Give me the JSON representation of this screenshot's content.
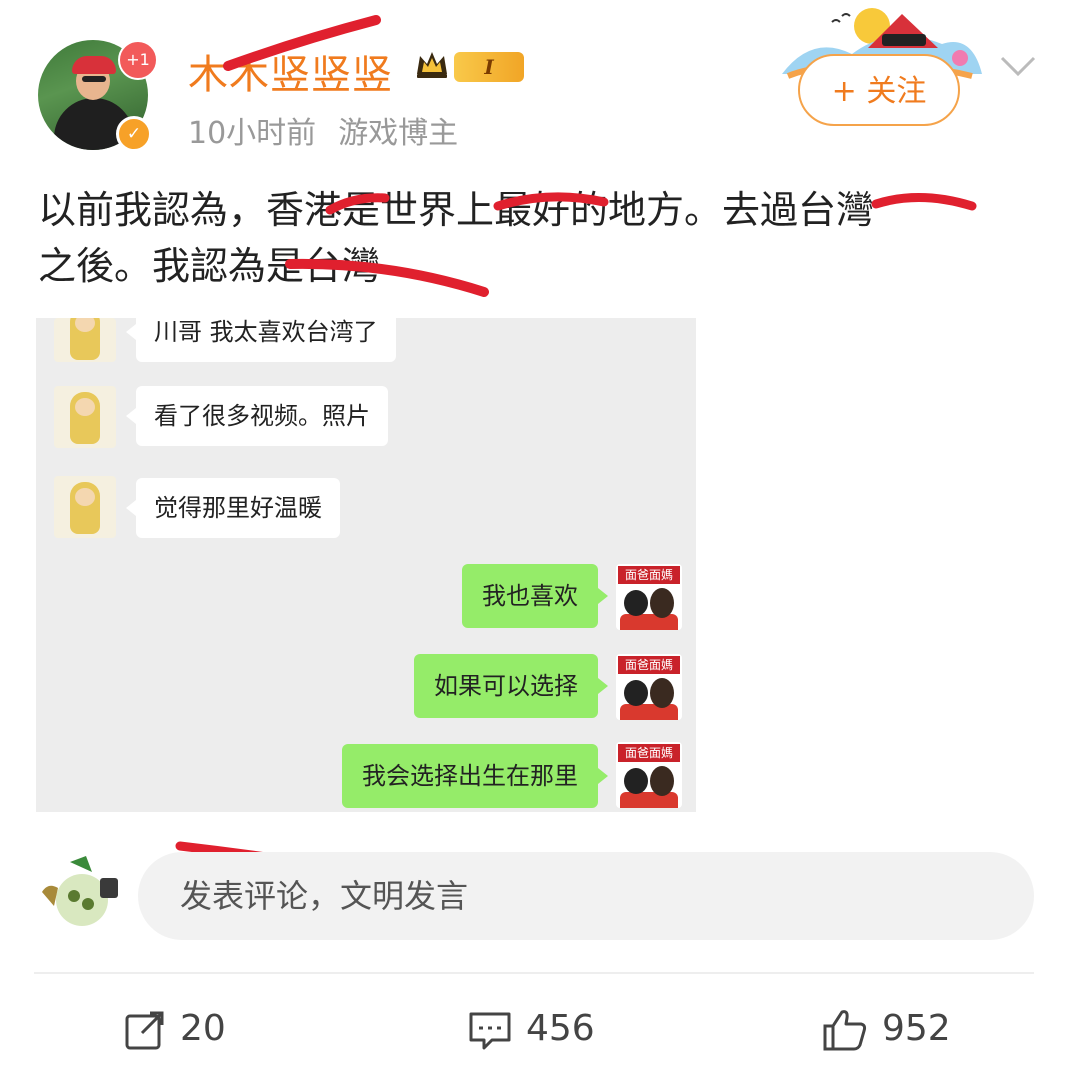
{
  "header": {
    "username": "木木竖竖竖",
    "level": "I",
    "notification_badge": "+1",
    "time_ago": "10小时前",
    "user_tag": "游戏博主",
    "follow_label": "+ 关注"
  },
  "post": {
    "line1": "以前我認為，香港是世界上最好的地方。去過台灣",
    "line2": "之後。我認為是台灣"
  },
  "chat": {
    "incoming": [
      "川哥 我太喜欢台湾了",
      "看了很多视频。照片",
      "觉得那里好温暖"
    ],
    "outgoing": [
      "我也喜欢",
      "如果可以选择",
      "我会选择出生在那里"
    ],
    "avatar_label": "面爸面媽"
  },
  "comment": {
    "placeholder": "发表评论，文明发言"
  },
  "actions": {
    "share_count": "20",
    "comment_count": "456",
    "like_count": "952"
  },
  "colors": {
    "username": "#f07b1e",
    "follow_border": "#f5a34a",
    "bubble_out": "#95ec69",
    "redaction": "#e0202e"
  }
}
